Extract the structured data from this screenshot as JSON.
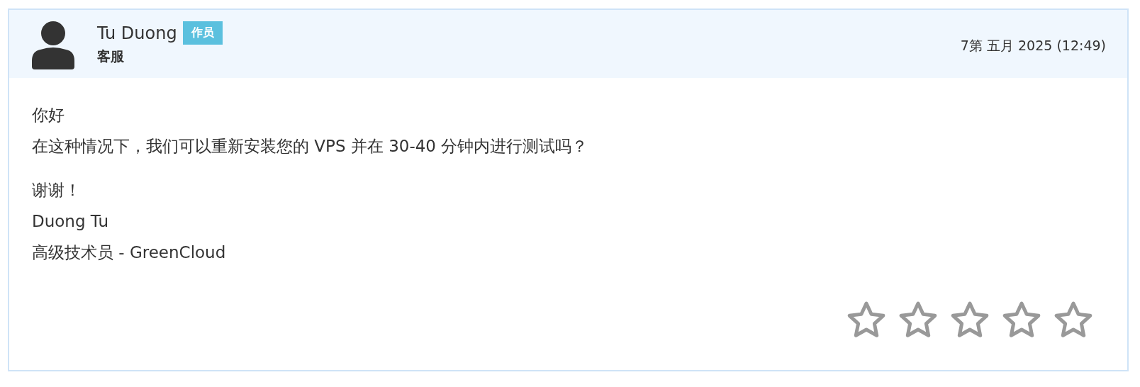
{
  "author": {
    "name": "Tu Duong",
    "badge": "作员",
    "role": "客服"
  },
  "date": "7第 五月 2025 (12:49)",
  "message": [
    [
      "你好",
      "在这种情况下，我们可以重新安装您的 VPS 并在 30-40 分钟内进行测试吗？"
    ],
    [
      "谢谢！",
      "Duong Tu",
      "高级技术员 - GreenCloud"
    ]
  ],
  "rating": {
    "stars": 0
  }
}
